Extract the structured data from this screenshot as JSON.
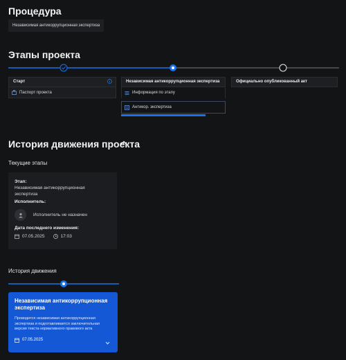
{
  "procedure": {
    "title": "Процедура",
    "chip": "Независимая антикоррупционная экспертиза"
  },
  "stages": {
    "title": "Этапы проекта",
    "columns": [
      {
        "title": "Старт",
        "items": [
          "Паспорт проекта"
        ]
      },
      {
        "title": "Независимая антикоррупционная экспертиза",
        "items": [
          "Информация по этапу",
          "Антикор. экспертиза"
        ]
      },
      {
        "title": "Официально опубликованный акт",
        "items": []
      }
    ]
  },
  "history": {
    "title": "История движения проекта",
    "current_label": "Текущие этапы",
    "card": {
      "stage_label": "Этап:",
      "stage_value": "Независимая антикоррупционная экспертиза",
      "executor_label": "Исполнитель:",
      "executor_value": "Исполнитель не назначен",
      "date_label": "Дата последнего изменения:",
      "date": "07.05.2025",
      "time": "17:03"
    },
    "movement_label": "История движения",
    "event": {
      "title": "Независимая антикоррупционная экспертиза",
      "description": "Проводится независимая антикоррупционная экспертиза и подготавливается заключительная версия текста нормативного правового акта",
      "date": "07.05.2025"
    }
  },
  "colors": {
    "accent": "#1a73e8",
    "card_blue": "#1558d6"
  },
  "icons": [
    "check-icon",
    "info-icon",
    "briefcase-icon",
    "list-icon",
    "document-icon",
    "chevron-up-icon",
    "user-icon",
    "calendar-icon",
    "clock-icon",
    "chevron-down-icon"
  ]
}
